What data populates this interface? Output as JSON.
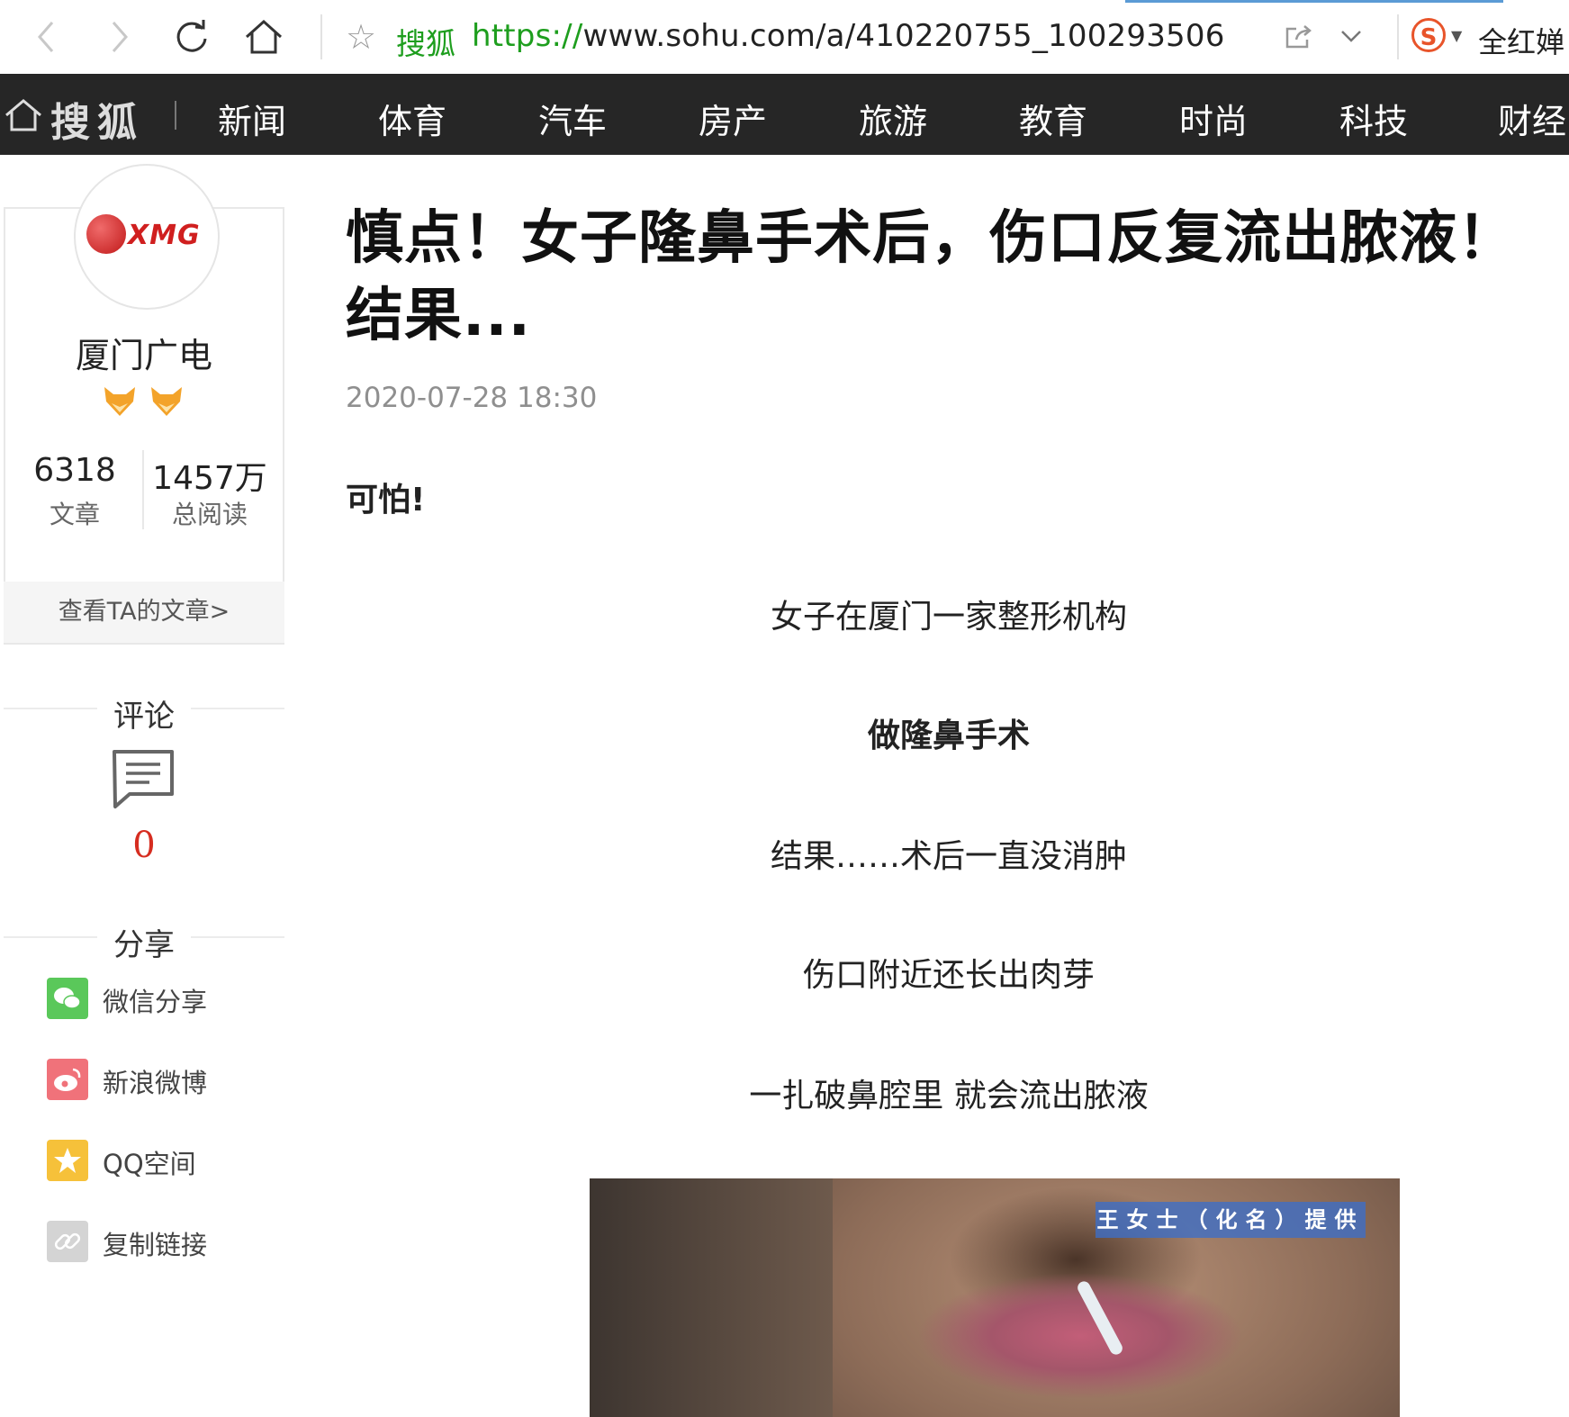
{
  "browser": {
    "site_name": "搜狐",
    "url_protocol": "https://",
    "url_rest": "www.sohu.com/a/410220755_100293506",
    "search_text": "全红婵",
    "search_engine_icon": "sogou-icon",
    "accent": "#1e9e1e"
  },
  "nav": {
    "logo": "搜狐",
    "items": [
      "新闻",
      "体育",
      "汽车",
      "房产",
      "旅游",
      "教育",
      "时尚",
      "科技",
      "财经"
    ],
    "background": "#262626"
  },
  "author": {
    "avatar_text": "XMG",
    "name": "厦门广电",
    "articles_count": "6318",
    "articles_label": "文章",
    "reads_count": "1457万",
    "reads_label": "总阅读",
    "view_link": "查看TA的文章>"
  },
  "comments": {
    "title": "评论",
    "count": "0"
  },
  "share": {
    "title": "分享",
    "items": [
      {
        "label": "微信分享",
        "icon": "wechat-icon",
        "color": "#5ac85a"
      },
      {
        "label": "新浪微博",
        "icon": "weibo-icon",
        "color": "#f0727a"
      },
      {
        "label": "QQ空间",
        "icon": "qzone-icon",
        "color": "#f6c13a"
      },
      {
        "label": "复制链接",
        "icon": "link-icon",
        "color": "#d4d4d4"
      }
    ]
  },
  "article": {
    "title": "慎点！女子隆鼻手术后，伤口反复流出脓液！结果...",
    "date": "2020-07-28 18:30",
    "lead": "可怕!",
    "paragraphs": [
      "女子在厦门一家整形机构",
      "做隆鼻手术",
      "结果……术后一直没消肿",
      "伤口附近还长出肉芽",
      "一扎破鼻腔里 就会流出脓液"
    ],
    "image_caption": "王女士（化名）提供"
  }
}
